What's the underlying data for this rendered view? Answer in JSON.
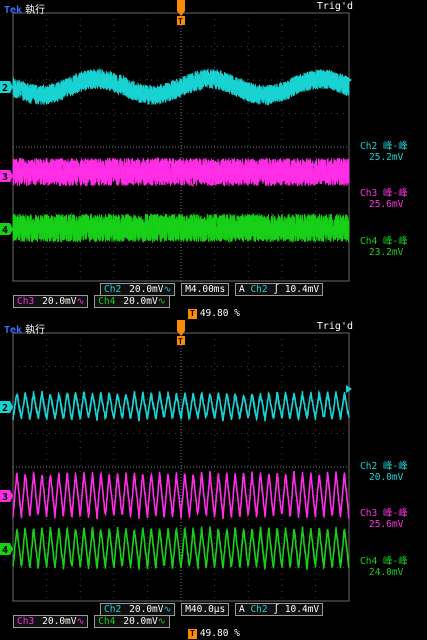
{
  "top": {
    "status": {
      "brand": "Tek",
      "mode": "執行",
      "trigger": "Trig'd"
    },
    "channels": [
      {
        "id": "2",
        "color": "#19d3d3"
      },
      {
        "id": "3",
        "color": "#ff2ee6"
      },
      {
        "id": "4",
        "color": "#18d018"
      }
    ],
    "measurements": [
      {
        "label": "Ch2 峰-峰",
        "value": "25.2mV",
        "color": "#19d3d3"
      },
      {
        "label": "Ch3 峰-峰",
        "value": "25.6mV",
        "color": "#ff2ee6"
      },
      {
        "label": "Ch4 峰-峰",
        "value": "23.2mV",
        "color": "#18d018"
      }
    ],
    "bar1": {
      "ch2_label": "Ch2",
      "ch2_scale": "20.0mV",
      "timebase": "M4.00ms",
      "trig_mode": "A",
      "trig_src": "Ch2",
      "trig_slope": "∫",
      "trig_level": "10.4mV"
    },
    "bar2": {
      "ch3_label": "Ch3",
      "ch3_scale": "20.0mV",
      "ch4_label": "Ch4",
      "ch4_scale": "20.0mV",
      "bw_mark": "⁴ᵂ"
    },
    "trigger_pos": {
      "marker": "T",
      "value": "49.80 %"
    }
  },
  "bottom": {
    "status": {
      "brand": "Tek",
      "mode": "執行",
      "trigger": "Trig'd"
    },
    "channels": [
      {
        "id": "2",
        "color": "#19d3d3"
      },
      {
        "id": "3",
        "color": "#ff2ee6"
      },
      {
        "id": "4",
        "color": "#18d018"
      }
    ],
    "measurements": [
      {
        "label": "Ch2 峰-峰",
        "value": "20.0mV",
        "color": "#19d3d3"
      },
      {
        "label": "Ch3 峰-峰",
        "value": "25.6mV",
        "color": "#ff2ee6"
      },
      {
        "label": "Ch4 峰-峰",
        "value": "24.0mV",
        "color": "#18d018"
      }
    ],
    "bar1": {
      "ch2_label": "Ch2",
      "ch2_scale": "20.0mV",
      "timebase": "M40.0µs",
      "trig_mode": "A",
      "trig_src": "Ch2",
      "trig_slope": "∫",
      "trig_level": "10.4mV"
    },
    "bar2": {
      "ch3_label": "Ch3",
      "ch3_scale": "20.0mV",
      "ch4_label": "Ch4",
      "ch4_scale": "20.0mV"
    },
    "trigger_pos": {
      "marker": "T",
      "value": "49.80 %"
    }
  }
}
